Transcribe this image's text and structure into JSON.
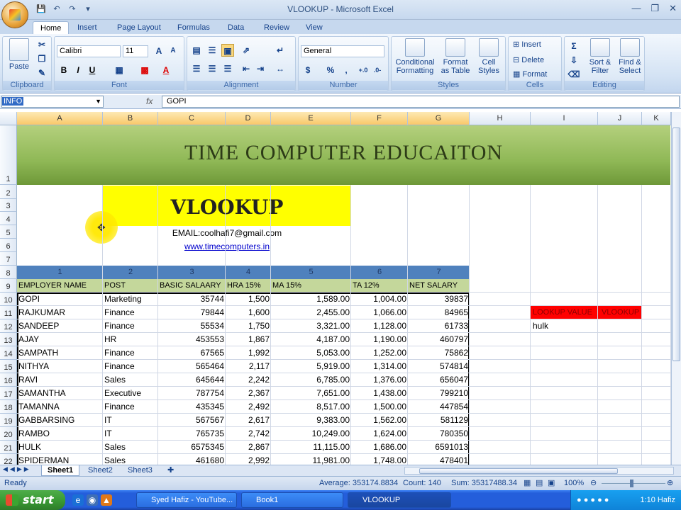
{
  "window": {
    "title": "VLOOKUP - Microsoft Excel"
  },
  "tabs": [
    "Home",
    "Insert",
    "Page Layout",
    "Formulas",
    "Data",
    "Review",
    "View"
  ],
  "ribbon": {
    "clipboard": {
      "label": "Clipboard",
      "paste": "Paste"
    },
    "font": {
      "label": "Font",
      "name": "Calibri",
      "size": "11",
      "bold": "B",
      "italic": "I",
      "underline": "U",
      "grow": "A",
      "shrink": "A"
    },
    "alignment": {
      "label": "Alignment"
    },
    "number": {
      "label": "Number",
      "format": "General",
      "currency": "$",
      "percent": "%",
      "comma": ","
    },
    "styles": {
      "label": "Styles",
      "conditional": "Conditional Formatting",
      "format_table": "Format as Table",
      "cell_styles": "Cell Styles"
    },
    "cells": {
      "label": "Cells",
      "insert": "Insert",
      "delete": "Delete",
      "format": "Format"
    },
    "editing": {
      "label": "Editing",
      "sort": "Sort & Filter",
      "find": "Find & Select"
    }
  },
  "formula_bar": {
    "name_box": "INFO",
    "fx": "fx",
    "content": "GOPI"
  },
  "columns": [
    "A",
    "B",
    "C",
    "D",
    "E",
    "F",
    "G",
    "H",
    "I",
    "J",
    "K"
  ],
  "rows": [
    "1",
    "2",
    "3",
    "4",
    "5",
    "6",
    "7",
    "8",
    "9",
    "10",
    "11",
    "12",
    "13",
    "14",
    "15",
    "16",
    "17",
    "18",
    "19",
    "20",
    "21",
    "22"
  ],
  "sheet": {
    "banner": "TIME COMPUTER EDUCAITON",
    "vlookup_title": "VLOOKUP",
    "email": "EMAIL:coolhafi7@gmail.com",
    "website": "www.timecomputers.in",
    "col_numbers": [
      "1",
      "2",
      "3",
      "4",
      "5",
      "6",
      "7"
    ],
    "headers": [
      "EMPLOYER NAME",
      "POST",
      "BASIC SALAARY",
      "HRA 15%",
      "MA 15%",
      "TA 12%",
      "NET SALARY"
    ],
    "data": [
      [
        "GOPI",
        "Marketing",
        "35744",
        "1,500",
        "1,589.00",
        "1,004.00",
        "39837"
      ],
      [
        "RAJKUMAR",
        "Finance",
        "79844",
        "1,600",
        "2,455.00",
        "1,066.00",
        "84965"
      ],
      [
        "SANDEEP",
        "Finance",
        "55534",
        "1,750",
        "3,321.00",
        "1,128.00",
        "61733"
      ],
      [
        "AJAY",
        "HR",
        "453553",
        "1,867",
        "4,187.00",
        "1,190.00",
        "460797"
      ],
      [
        "SAMPATH",
        "Finance",
        "67565",
        "1,992",
        "5,053.00",
        "1,252.00",
        "75862"
      ],
      [
        "NITHYA",
        "Finance",
        "565464",
        "2,117",
        "5,919.00",
        "1,314.00",
        "574814"
      ],
      [
        "RAVI",
        "Sales",
        "645644",
        "2,242",
        "6,785.00",
        "1,376.00",
        "656047"
      ],
      [
        "SAMANTHA",
        "Executive",
        "787754",
        "2,367",
        "7,651.00",
        "1,438.00",
        "799210"
      ],
      [
        "TAMANNA",
        "Finance",
        "435345",
        "2,492",
        "8,517.00",
        "1,500.00",
        "447854"
      ],
      [
        "GABBARSING",
        "IT",
        "567567",
        "2,617",
        "9,383.00",
        "1,562.00",
        "581129"
      ],
      [
        "RAMBO",
        "IT",
        "765735",
        "2,742",
        "10,249.00",
        "1,624.00",
        "780350"
      ],
      [
        "HULK",
        "Sales",
        "6575345",
        "2,867",
        "11,115.00",
        "1,686.00",
        "6591013"
      ],
      [
        "SPIDERMAN",
        "Sales",
        "461680",
        "2,992",
        "11,981.00",
        "1,748.00",
        "478401"
      ]
    ],
    "lookup_label": "LOOKUP VALUE",
    "lookup_result_label": "VLOOKUP",
    "lookup_value": "hulk"
  },
  "sheet_tabs": [
    "Sheet1",
    "Sheet2",
    "Sheet3"
  ],
  "status": {
    "ready": "Ready",
    "average": "Average: 353174.8834",
    "count": "Count: 140",
    "sum": "Sum: 35317488.34",
    "zoom": "100%"
  },
  "taskbar": {
    "start": "start",
    "items": [
      "Syed Hafiz - YouTube...",
      "Book1",
      "VLOOKUP"
    ],
    "time": "1:10 Hafiz"
  }
}
